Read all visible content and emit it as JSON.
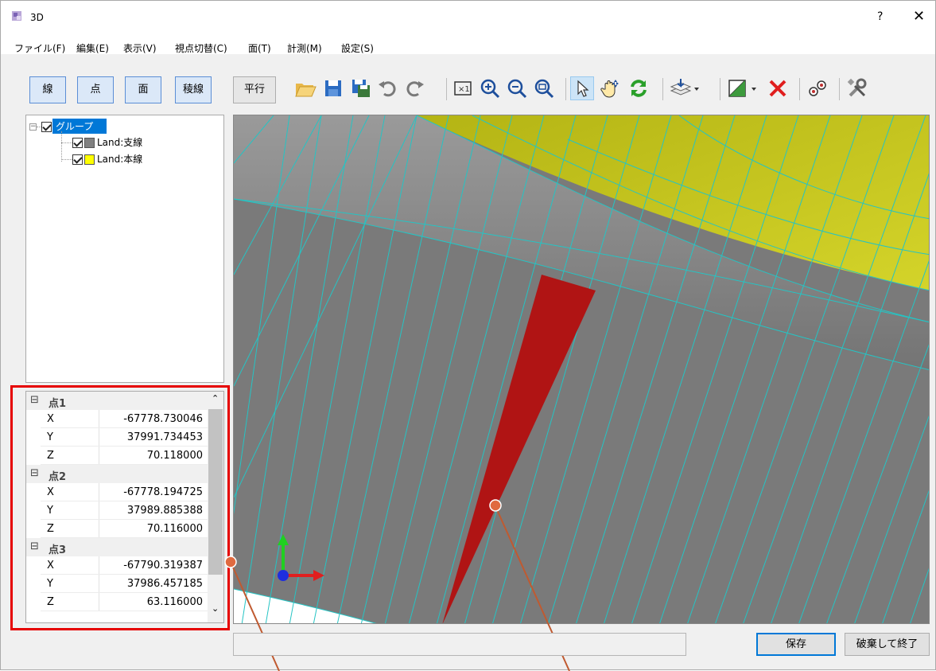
{
  "window": {
    "title": "3D",
    "help_label": "?",
    "close_label": "✕"
  },
  "menu": [
    {
      "label": "ファイル(F)"
    },
    {
      "label": "編集(E)"
    },
    {
      "label": "表示(V)"
    },
    {
      "label": "視点切替(C)"
    },
    {
      "label": "面(T)"
    },
    {
      "label": "計測(M)"
    },
    {
      "label": "設定(S)"
    }
  ],
  "mode_buttons": [
    {
      "label": "線"
    },
    {
      "label": "点"
    },
    {
      "label": "面"
    },
    {
      "label": "稜線"
    }
  ],
  "projection_button": {
    "label": "平行"
  },
  "toolbar_icons": [
    "open-folder-icon",
    "save-icon",
    "save-as-icon",
    "undo-icon",
    "redo-icon",
    "fit-extent-icon",
    "zoom-in-icon",
    "zoom-out-icon",
    "zoom-window-icon",
    "select-arrow-icon",
    "pan-hand-icon",
    "refresh-icon",
    "layers-icon",
    "face-color-icon",
    "delete-icon",
    "points-icon",
    "settings-tools-icon"
  ],
  "tree": {
    "root": {
      "label": "グループ",
      "checked": true
    },
    "children": [
      {
        "label": "Land:支線",
        "color": "#808080",
        "checked": true
      },
      {
        "label": "Land:本線",
        "color": "#ffff00",
        "checked": true
      }
    ]
  },
  "properties": [
    {
      "category": "点1",
      "rows": [
        {
          "key": "X",
          "value": "-67778.730046"
        },
        {
          "key": "Y",
          "value": "37991.734453"
        },
        {
          "key": "Z",
          "value": "70.118000"
        }
      ]
    },
    {
      "category": "点2",
      "rows": [
        {
          "key": "X",
          "value": "-67778.194725"
        },
        {
          "key": "Y",
          "value": "37989.885388"
        },
        {
          "key": "Z",
          "value": "70.116000"
        }
      ]
    },
    {
      "category": "点3",
      "rows": [
        {
          "key": "X",
          "value": "-67790.319387"
        },
        {
          "key": "Y",
          "value": "37986.457185"
        },
        {
          "key": "Z",
          "value": "63.116000"
        }
      ]
    }
  ],
  "collapse_glyph": "⊟",
  "scroll_up_glyph": "⌃",
  "scroll_down_glyph": "⌄",
  "status_text": "",
  "buttons": {
    "save_label": "保存",
    "discard_label": "破棄して終了"
  },
  "colors": {
    "selection_red": "#b01414",
    "mesh_line": "#25c4c4",
    "mainline_yellow": "#c8c81e",
    "surface_gray": "#7a7a7a",
    "highlight_box": "#e60000"
  }
}
